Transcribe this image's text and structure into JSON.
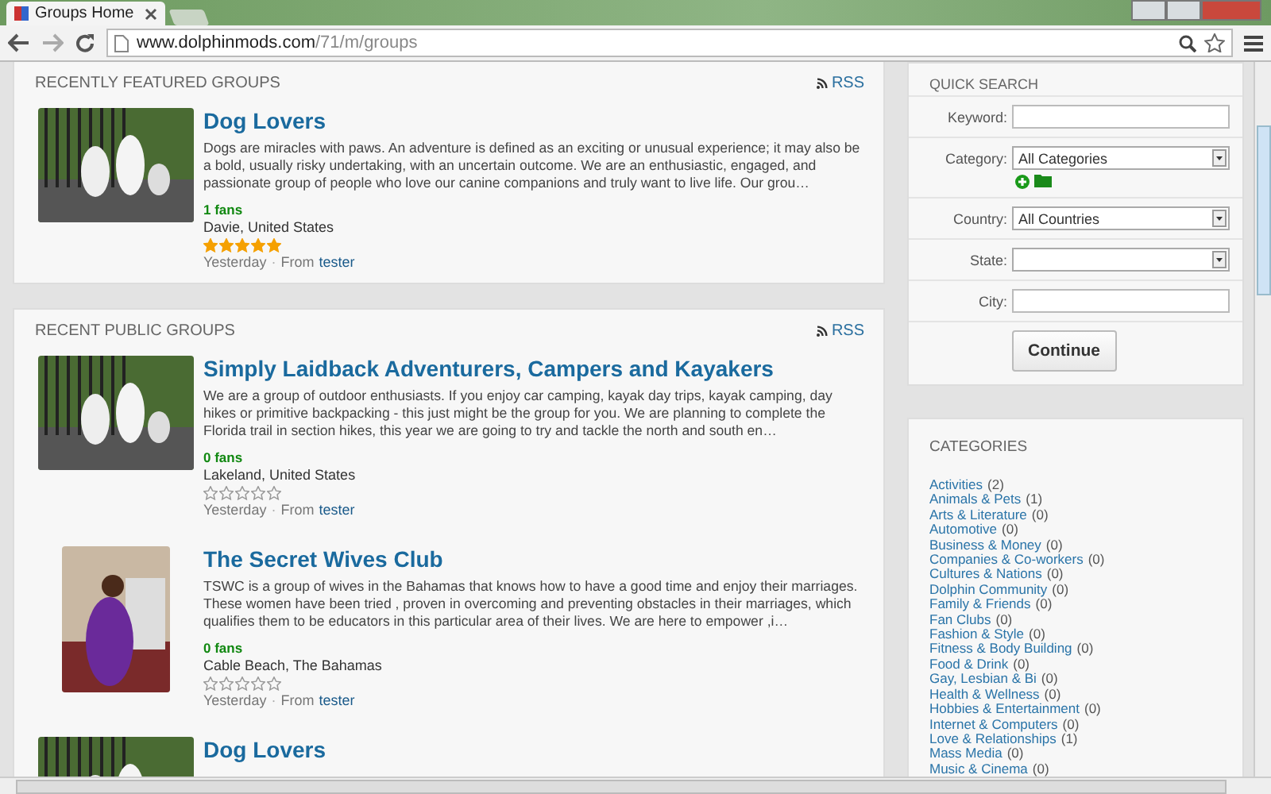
{
  "browser": {
    "tab_title": "Groups Home",
    "url_domain": "www.dolphinmods.com",
    "url_path": "/71/m/groups"
  },
  "featured": {
    "title": "RECENTLY FEATURED GROUPS",
    "rss": "RSS",
    "groups": [
      {
        "name": "Dog Lovers",
        "kind": "landscape",
        "description": "Dogs are miracles with paws. An adventure is defined as an exciting or unusual experience; it may also be a bold, usually risky undertaking, with an uncertain outcome. We are an enthusiastic, engaged, and passionate group of people who love our canine companions and truly want to live life. Our grou…",
        "fans": "1 fans",
        "location": "Davie, United States",
        "stars": 5,
        "date": "Yesterday",
        "separator": "·",
        "from": "From",
        "author": "tester"
      }
    ]
  },
  "recent": {
    "title": "RECENT PUBLIC GROUPS",
    "rss": "RSS",
    "groups": [
      {
        "name": "Simply Laidback Adventurers, Campers and Kayakers",
        "kind": "landscape",
        "description": "We are a group of outdoor enthusiasts. If you enjoy car camping, kayak day trips, kayak camping, day hikes or primitive backpacking - this just might be the group for you.  We are planning to complete the Florida trail in section hikes, this year we are going to try and tackle the north and south en…",
        "fans": "0 fans",
        "location": "Lakeland, United States",
        "stars": 0,
        "date": "Yesterday",
        "separator": "·",
        "from": "From",
        "author": "tester"
      },
      {
        "name": "The Secret Wives Club",
        "kind": "portrait",
        "description": "TSWC is a group of wives in the Bahamas that knows how to have a good time and enjoy their marriages. These women have been tried , proven in overcoming and preventing obstacles in their marriages, which qualifies them to be educators in this particular area of their lives. We are here to empower ,i…",
        "fans": "0 fans",
        "location": "Cable Beach, The Bahamas",
        "stars": 0,
        "date": "Yesterday",
        "separator": "·",
        "from": "From",
        "author": "tester"
      },
      {
        "name": "Dog Lovers",
        "kind": "landscape"
      }
    ]
  },
  "quick_search": {
    "title": "QUICK SEARCH",
    "fields": [
      {
        "label": "Keyword:",
        "kind": "text"
      },
      {
        "label": "Category:",
        "kind": "select",
        "value": "All Categories",
        "extras": true
      },
      {
        "label": "Country:",
        "kind": "select",
        "value": "All Countries"
      },
      {
        "label": "State:",
        "kind": "select"
      },
      {
        "label": "City:",
        "kind": "text"
      }
    ],
    "button": "Continue"
  },
  "categories": {
    "title": "CATEGORIES",
    "items": [
      {
        "name": "Activities",
        "count": "(2)"
      },
      {
        "name": "Animals & Pets",
        "count": "(1)"
      },
      {
        "name": "Arts & Literature",
        "count": "(0)"
      },
      {
        "name": "Automotive",
        "count": "(0)"
      },
      {
        "name": "Business & Money",
        "count": "(0)"
      },
      {
        "name": "Companies & Co-workers",
        "count": "(0)"
      },
      {
        "name": "Cultures & Nations",
        "count": "(0)"
      },
      {
        "name": "Dolphin Community",
        "count": "(0)"
      },
      {
        "name": "Family & Friends",
        "count": "(0)"
      },
      {
        "name": "Fan Clubs",
        "count": "(0)"
      },
      {
        "name": "Fashion & Style",
        "count": "(0)"
      },
      {
        "name": "Fitness & Body Building",
        "count": "(0)"
      },
      {
        "name": "Food & Drink",
        "count": "(0)"
      },
      {
        "name": "Gay, Lesbian & Bi",
        "count": "(0)"
      },
      {
        "name": "Health & Wellness",
        "count": "(0)"
      },
      {
        "name": "Hobbies & Entertainment",
        "count": "(0)"
      },
      {
        "name": "Internet & Computers",
        "count": "(0)"
      },
      {
        "name": "Love & Relationships",
        "count": "(1)"
      },
      {
        "name": "Mass Media",
        "count": "(0)"
      },
      {
        "name": "Music & Cinema",
        "count": "(0)"
      }
    ]
  }
}
